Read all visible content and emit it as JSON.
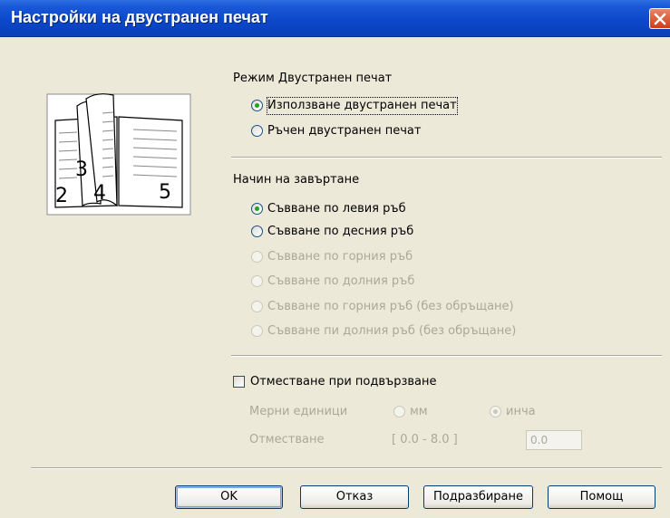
{
  "window": {
    "title": "Настройки на двустранен печат"
  },
  "duplex_mode": {
    "heading": "Режим Двустранен печат",
    "options": [
      {
        "label": "Използване двустранен печат",
        "selected": true
      },
      {
        "label": "Ръчен двустранен печат",
        "selected": false
      }
    ]
  },
  "illustration": {
    "page_numbers": [
      "3",
      "2",
      "4",
      "5"
    ]
  },
  "binding": {
    "heading": "Начин на завъртане",
    "options": [
      {
        "label": "Съвване по левия ръб",
        "selected": true,
        "enabled": true
      },
      {
        "label": "Съвване по десния ръб",
        "selected": false,
        "enabled": true
      },
      {
        "label": "Съвване по горния ръб",
        "selected": false,
        "enabled": false
      },
      {
        "label": "Съвване по долния ръб",
        "selected": false,
        "enabled": false
      },
      {
        "label": "Съвване по горния ръб (без обръщане)",
        "selected": false,
        "enabled": false
      },
      {
        "label": "Съвване пи долния ръб (без обръщане)",
        "selected": false,
        "enabled": false
      }
    ]
  },
  "offset": {
    "checkbox_label": "Отместване при подвързване",
    "checked": false,
    "units_label": "Мерни единици",
    "unit_options": [
      {
        "label": "мм",
        "selected": false
      },
      {
        "label": "инча",
        "selected": true
      }
    ],
    "offset_label": "Отместване",
    "range": "[ 0.0 - 8.0 ]",
    "value": "0.0"
  },
  "buttons": {
    "ok": "OK",
    "cancel": "Отказ",
    "default": "Подразбиране",
    "help": "Помощ"
  },
  "colors": {
    "title_bar": "#0a47c9",
    "dialog_bg": "#ece9d8",
    "radio_selected": "#21a121",
    "close": "#d23a14"
  }
}
